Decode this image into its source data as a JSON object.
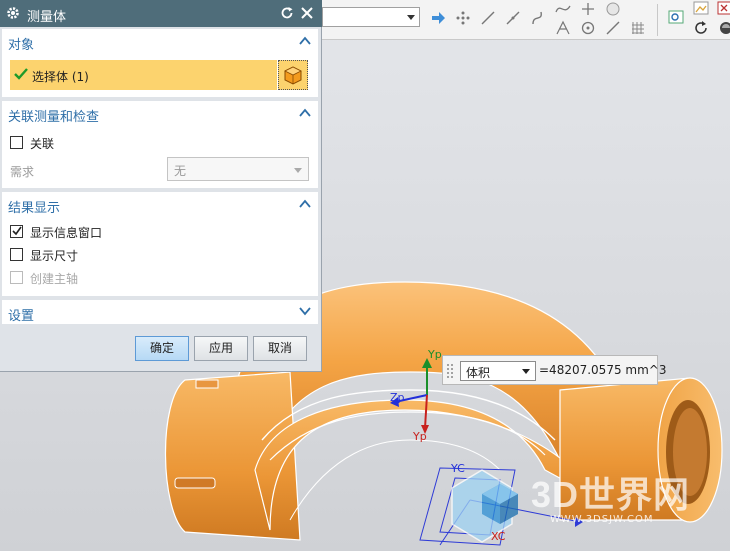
{
  "dialog": {
    "title": "测量体",
    "object_section": {
      "header": "对象",
      "selection_label": "选择体 (1)"
    },
    "associative_section": {
      "header": "关联测量和检查",
      "associative_label": "关联",
      "associative_checked": false,
      "requirement_label": "需求",
      "requirement_value": "无"
    },
    "results_section": {
      "header": "结果显示",
      "options": [
        {
          "label": "显示信息窗口",
          "checked": true,
          "enabled": true
        },
        {
          "label": "显示尺寸",
          "checked": false,
          "enabled": true
        },
        {
          "label": "创建主轴",
          "checked": false,
          "enabled": false
        }
      ]
    },
    "settings_section": {
      "header": "设置",
      "collapsed": true
    },
    "buttons": {
      "ok": "确定",
      "apply": "应用",
      "cancel": "取消"
    }
  },
  "toolbar": {
    "filter_value": "",
    "icons": [
      "arrow-right-icon",
      "point-grid-icon",
      "line-icon",
      "line-2-icon",
      "curve-icon",
      "spline-icon",
      "plus-icon",
      "cloud-icon",
      "arc-icon",
      "circle-icon",
      "line-3-icon",
      "grid-icon",
      "view-icon",
      "rotate-icon",
      "image-icon",
      "render-icon"
    ]
  },
  "measurement": {
    "type": "体积",
    "value": "=48207.0575 mm^3"
  },
  "axes": {
    "yc": "YC",
    "xc": "XC",
    "yp": "Yp",
    "zp": "Zp",
    "yp2": "Yp"
  },
  "watermark": {
    "logo_text": "3D世界网",
    "url": "WWW.3DSJW.COM"
  },
  "colors": {
    "title_bar": "#4f6d7a",
    "selection_highlight": "#fcd36e",
    "section_header_text": "#2f6fa8",
    "model_orange": "#f3a64c"
  }
}
